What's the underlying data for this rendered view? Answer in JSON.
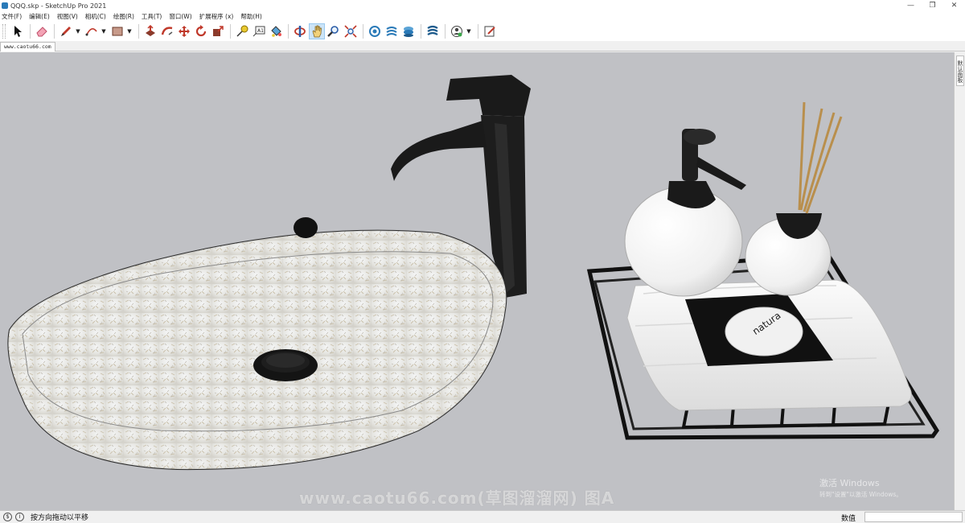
{
  "window": {
    "title": "QQQ.skp - SketchUp Pro 2021",
    "minimize": "—",
    "maximize": "❐",
    "close": "✕"
  },
  "menu": [
    "文件(F)",
    "编辑(E)",
    "视图(V)",
    "相机(C)",
    "绘图(R)",
    "工具(T)",
    "窗口(W)",
    "扩展程序 (x)",
    "帮助(H)"
  ],
  "toolbar": {
    "icons": [
      "select-icon",
      "eraser-icon",
      "pencil-line-icon",
      "arc-icon",
      "rectangle-icon",
      "push-pull-icon",
      "follow-me-icon",
      "move-icon",
      "rotate-icon",
      "scale-icon",
      "tape-measure-icon",
      "text-icon",
      "paint-bucket-icon",
      "orbit-icon",
      "pan-icon",
      "zoom-icon",
      "zoom-extents-icon",
      "3d-warehouse-icon",
      "extension-warehouse-icon",
      "layout-icon",
      "extension-manager-icon",
      "user-account-icon",
      "new-sketch-icon"
    ],
    "active": "pan-icon"
  },
  "scene_tab": "www.caotu66.com",
  "tray": {
    "label": "默认面板"
  },
  "viewport": {
    "background": "#c0c1c5",
    "watermark": "www.caotu66.com(草图溜溜网) 图A",
    "activation_title": "激活 Windows",
    "activation_sub": "转到\"设置\"以激活 Windows。",
    "soap_brand": "natura"
  },
  "status": {
    "text": "按方向拖动以平移",
    "measure_label": "数值",
    "measure_value": ""
  }
}
